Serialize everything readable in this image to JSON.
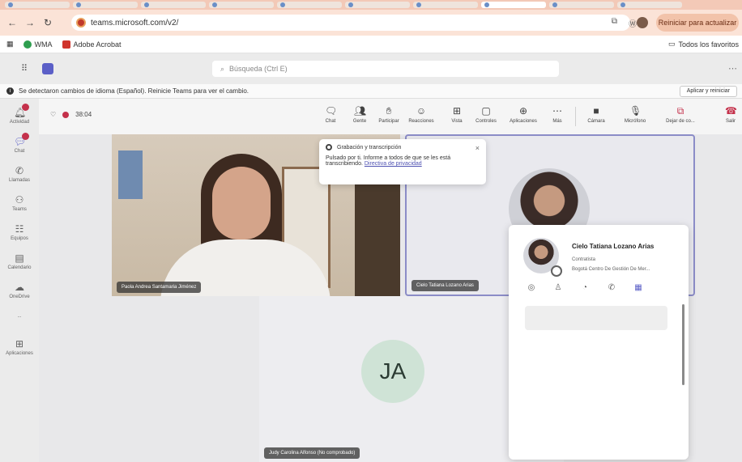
{
  "browser": {
    "tabs": [
      "",
      "",
      "",
      "",
      "",
      "",
      "",
      "",
      "",
      "",
      "",
      ""
    ],
    "url": "teams.microsoft.com/v2/",
    "relaunch_label": "Reiniciar para actualizar",
    "bookmarks": [
      "WMA",
      "Adobe Acrobat"
    ],
    "all_bookmarks": "Todos los favoritos"
  },
  "teams": {
    "search_placeholder": "Búsqueda (Ctrl E)",
    "notice_text": "Se detectaron cambios de idioma (Español). Reinicie Teams para ver el cambio.",
    "notice_button": "Aplicar y reiniciar"
  },
  "rail": [
    {
      "label": "Actividad",
      "icon": "bell-icon"
    },
    {
      "label": "Chat",
      "icon": "chat-icon"
    },
    {
      "label": "Llamadas",
      "icon": "phone-icon"
    },
    {
      "label": "Teams",
      "icon": "teams-icon"
    },
    {
      "label": "Equipos",
      "icon": "people-icon"
    },
    {
      "label": "Calendario",
      "icon": "calendar-icon"
    },
    {
      "label": "OneDrive",
      "icon": "onedrive-icon"
    },
    {
      "label": "...",
      "icon": "more-icon"
    },
    {
      "label": "Aplicaciones",
      "icon": "apps-icon"
    }
  ],
  "meeting": {
    "timer": "38:04",
    "toolbar": [
      {
        "label": "Chat",
        "icon": "chat-icon"
      },
      {
        "label": "Gente",
        "icon": "people-icon"
      },
      {
        "label": "Participar",
        "icon": "raise-hand-icon"
      },
      {
        "label": "Reacciones",
        "icon": "reaction-icon"
      },
      {
        "label": "Vista",
        "icon": "view-icon"
      },
      {
        "label": "Controles",
        "icon": "controls-icon"
      },
      {
        "label": "Aplicaciones",
        "icon": "apps-icon"
      },
      {
        "label": "Más",
        "icon": "more-icon"
      },
      {
        "label": "Cámara",
        "icon": "camera-icon"
      },
      {
        "label": "Micrófono",
        "icon": "mic-icon"
      },
      {
        "label": "Dejar de co...",
        "icon": "share-icon"
      },
      {
        "label": "Salir",
        "icon": "leave-icon"
      }
    ],
    "participants": [
      {
        "name": "Paola Andrea Santamaria Jiménez"
      },
      {
        "name": "Cielo Tatiana Lozano Arias"
      },
      {
        "name": "Judy Carolina Alfonso (No comprobado)",
        "initials": "JA"
      }
    ],
    "caption_popup": {
      "title": "Grabación y transcripción",
      "body": "Pulsado por ti. Informe a todos de que se les está transcribiendo.",
      "link": "Directiva de privacidad",
      "close": "×"
    },
    "profile_card": {
      "name": "Cielo Tatiana Lozano Arias",
      "role": "Contratista",
      "org": "Bogotá Centro De Gestión De Mer...",
      "actions": [
        "chat-icon",
        "people-icon",
        "video-icon",
        "phone-icon",
        "calendar-icon"
      ]
    }
  },
  "colors": {
    "accent": "#5b5fc7",
    "record": "#c4314b",
    "browser_bar": "#fbe3d7"
  }
}
